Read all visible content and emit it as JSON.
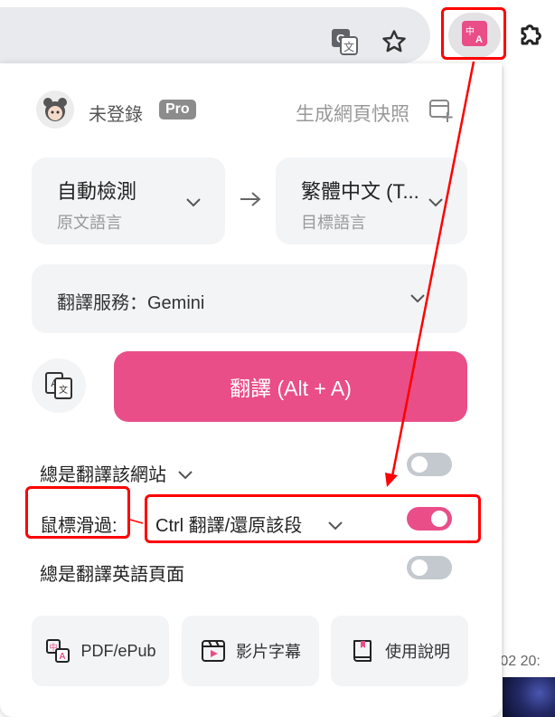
{
  "browser": {
    "translate_icon": "google-translate-icon",
    "star_icon": "bookmark-star-icon",
    "extension_icon": "immersive-translate-icon",
    "puzzle_icon": "extensions-puzzle-icon"
  },
  "page_fragment": {
    "text": "-02 20:"
  },
  "popup": {
    "user": {
      "name": "未登錄",
      "badge": "Pro"
    },
    "snapshot_label": "生成網頁快照",
    "source_lang": {
      "value": "自動檢測",
      "caption": "原文語言"
    },
    "target_lang": {
      "value": "繁體中文 (T...",
      "caption": "目標語言"
    },
    "service": {
      "label": "翻譯服務：Gemini"
    },
    "translate_button": "翻譯 (Alt + A)",
    "options": {
      "always_site": {
        "label": "總是翻譯該網站",
        "enabled": false
      },
      "hover": {
        "label": "鼠標滑過:",
        "value": "Ctrl 翻譯/還原該段",
        "enabled": true
      },
      "always_english": {
        "label": "總是翻譯英語頁面",
        "enabled": false
      }
    },
    "tools": [
      {
        "label": "PDF/ePub",
        "icon": "pdf-translate-icon"
      },
      {
        "label": "影片字幕",
        "icon": "video-subtitle-icon"
      },
      {
        "label": "使用說明",
        "icon": "manual-book-icon"
      }
    ]
  },
  "colors": {
    "accent": "#e94e88",
    "annotation": "#ff0000",
    "toggle_off": "#c4c9cf"
  }
}
